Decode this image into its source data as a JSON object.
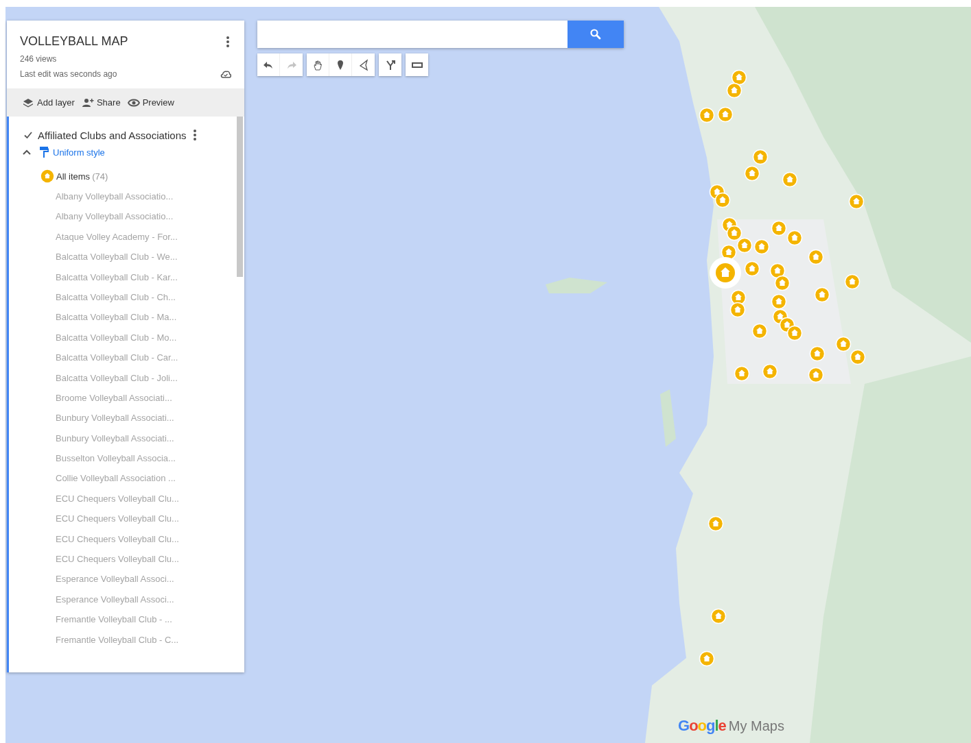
{
  "panel": {
    "title": "VOLLEYBALL MAP",
    "views": "246 views",
    "last_edit": "Last edit was seconds ago",
    "actions": [
      {
        "kind": "layer",
        "label": "Add layer"
      },
      {
        "kind": "share",
        "label": "Share"
      },
      {
        "kind": "preview",
        "label": "Preview"
      }
    ],
    "layer": {
      "name": "Affiliated Clubs and Associations",
      "checked": true,
      "expanded": true,
      "style_link": "Uniform style",
      "all_items": "All items",
      "count": "(74)",
      "items": [
        "Albany Volleyball Associatio...",
        "Albany Volleyball Associatio...",
        "Ataque Volley Academy - For...",
        "Balcatta Volleyball Club - We...",
        "Balcatta Volleyball Club - Kar...",
        "Balcatta Volleyball Club - Ch...",
        "Balcatta Volleyball Club - Ma...",
        "Balcatta Volleyball Club - Mo...",
        "Balcatta Volleyball Club - Car...",
        "Balcatta Volleyball Club - Joli...",
        "Broome Volleyball Associati...",
        "Bunbury Volleyball Associati...",
        "Bunbury Volleyball Associati...",
        "Busselton Volleyball Associa...",
        "Collie Volleyball Association ...",
        "ECU Chequers Volleyball Clu...",
        "ECU Chequers Volleyball Clu...",
        "ECU Chequers Volleyball Clu...",
        "ECU Chequers Volleyball Clu...",
        "Esperance Volleyball Associ...",
        "Esperance Volleyball Associ...",
        "Fremantle Volleyball Club - ...",
        "Fremantle Volleyball Club - C..."
      ]
    }
  },
  "toolbar": [
    [
      {
        "kind": "undo",
        "disabled": false
      },
      {
        "kind": "redo",
        "disabled": true
      }
    ],
    [
      {
        "kind": "hand",
        "disabled": false
      },
      {
        "kind": "marker",
        "disabled": false
      },
      {
        "kind": "line",
        "disabled": false
      }
    ],
    [
      {
        "kind": "route",
        "disabled": false
      }
    ],
    [
      {
        "kind": "ruler",
        "disabled": false
      }
    ]
  ],
  "branding": {
    "logo": "Google",
    "product": "My Maps"
  }
}
